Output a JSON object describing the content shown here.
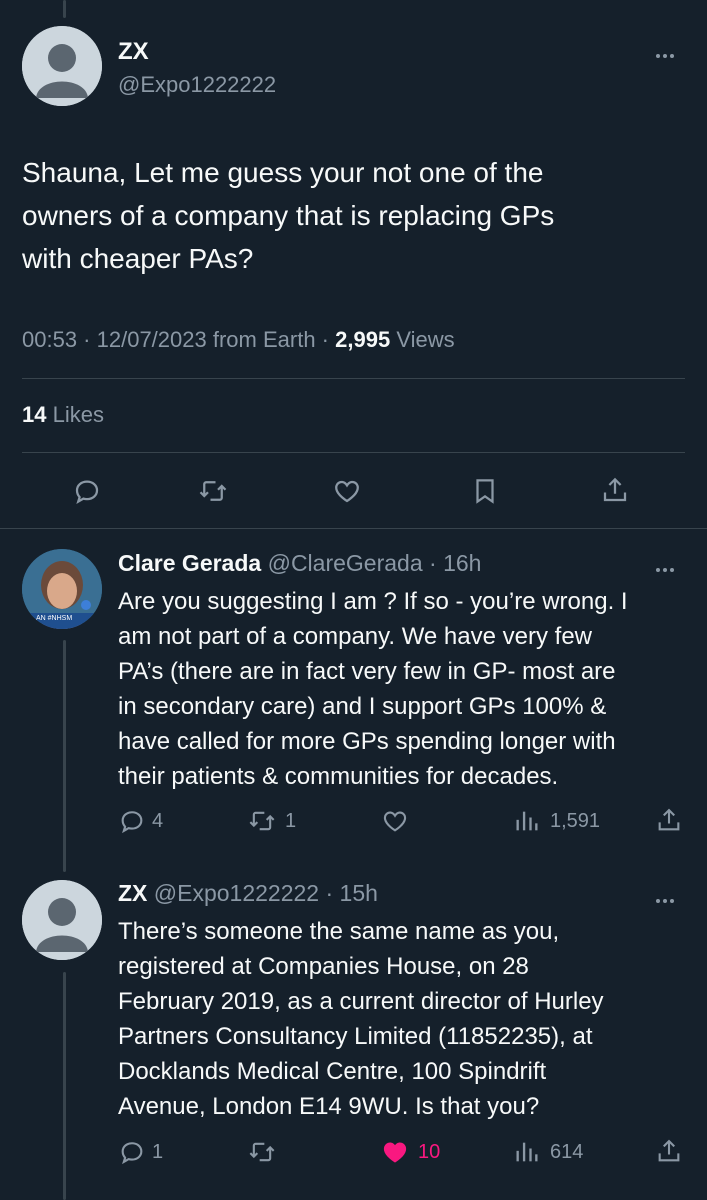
{
  "main_tweet": {
    "author_name": "ZX",
    "author_handle": "@Expo1222222",
    "text_lines": [
      "Shauna, Let me guess your not one of the",
      "owners of a company that is replacing GPs",
      "with cheaper PAs?"
    ],
    "time": "00:53",
    "date": "12/07/2023",
    "source": "from Earth",
    "views_count": "2,995",
    "views_label": "Views",
    "likes_count": "14",
    "likes_label": "Likes"
  },
  "reply1": {
    "author_name": "Clare Gerada",
    "author_handle": "@ClareGerada",
    "time": "16h",
    "avatar_banner": "AN #NHSM",
    "text_lines": [
      "Are you suggesting I am ? If so - you’re wrong. I",
      "am not part of a company. We have very few",
      "PA’s (there are in fact very few in GP- most are",
      "in secondary care) and I support GPs 100% &",
      "have called for more GPs spending longer with",
      "their patients & communities for decades."
    ],
    "replies": "4",
    "retweets": "1",
    "likes": "",
    "views": "1,591"
  },
  "reply2": {
    "author_name": "ZX",
    "author_handle": "@Expo1222222",
    "time": "15h",
    "text_lines": [
      "There’s someone the same name as you,",
      "registered at Companies House, on 28",
      "February 2019, as a current director of Hurley",
      "Partners Consultancy Limited (11852235), at",
      "Docklands Medical Centre, 100 Spindrift",
      "Avenue, London E14 9WU. Is that you?"
    ],
    "replies": "1",
    "retweets": "",
    "likes": "10",
    "views": "614"
  },
  "colors": {
    "background": "#15202b",
    "text": "#f7f9f9",
    "muted": "#8b98a5",
    "like_active": "#f91880",
    "divider": "#38444d"
  },
  "icons": [
    "reply-icon",
    "retweet-icon",
    "like-icon",
    "bookmark-icon",
    "share-icon",
    "views-icon",
    "more-icon"
  ]
}
